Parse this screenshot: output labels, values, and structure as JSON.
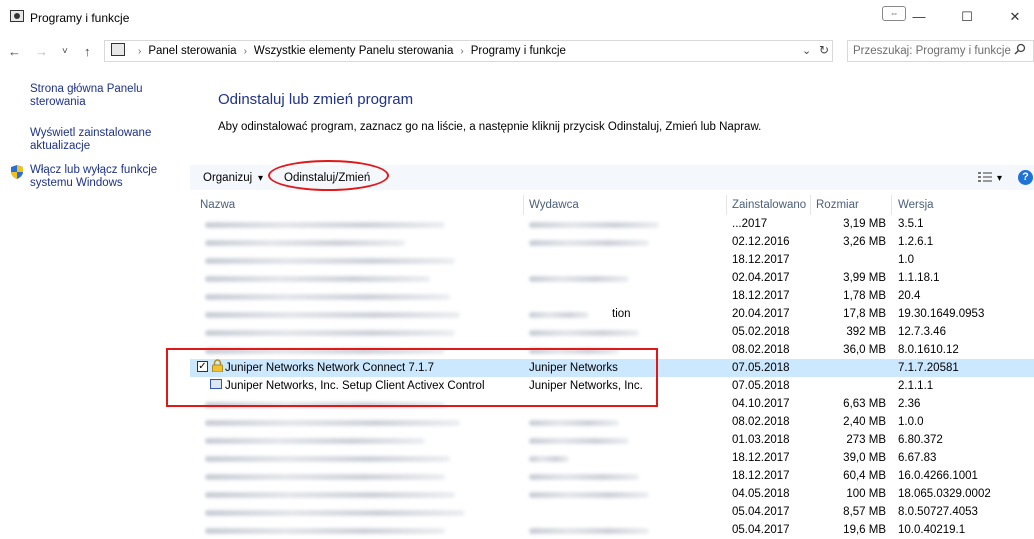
{
  "window": {
    "title": "Programy i funkcje",
    "minimize": "—",
    "maximize": "☐",
    "close": "✕"
  },
  "nav": {
    "back": "←",
    "forward": "→",
    "recent": "˅",
    "up": "↑"
  },
  "address": {
    "crumbs": [
      "Panel sterowania",
      "Wszystkie elementy Panelu sterowania",
      "Programy i funkcje"
    ],
    "dropdown": "⌄",
    "refresh": "↻"
  },
  "search": {
    "placeholder": "Przeszukaj: Programy i funkcje",
    "icon": "search-icon"
  },
  "sidebar": {
    "items": [
      {
        "label": "Strona główna Panelu sterowania"
      },
      {
        "label": "Wyświetl zainstalowane aktualizacje"
      },
      {
        "label": "Włącz lub wyłącz funkcje systemu Windows"
      }
    ]
  },
  "main": {
    "heading": "Odinstaluj lub zmień program",
    "description": "Aby odinstalować program, zaznacz go na liście, a następnie kliknij przycisk Odinstaluj, Zmień lub Napraw."
  },
  "toolbar": {
    "organize": "Organizuj",
    "organize_arrow": "▾",
    "uninstall": "Odinstaluj/Zmień",
    "view_arrow": "▾",
    "help": "?"
  },
  "columns": {
    "name": "Nazwa",
    "publisher": "Wydawca",
    "installed": "Zainstalowano",
    "size": "Rozmiar",
    "version": "Wersja"
  },
  "rows": [
    {
      "name": "",
      "publisher": "",
      "installed": "...2017",
      "size": "3,19 MB",
      "version": "3.5.1"
    },
    {
      "name": "",
      "publisher": "",
      "installed": "02.12.2016",
      "size": "3,26 MB",
      "version": "1.2.6.1"
    },
    {
      "name": "",
      "publisher": "",
      "installed": "18.12.2017",
      "size": "",
      "version": "1.0"
    },
    {
      "name": "",
      "publisher": "",
      "installed": "02.04.2017",
      "size": "3,99 MB",
      "version": "1.1.18.1"
    },
    {
      "name": "",
      "publisher": "",
      "installed": "18.12.2017",
      "size": "1,78 MB",
      "version": "20.4"
    },
    {
      "name": "",
      "publisher": "...tion",
      "installed": "20.04.2017",
      "size": "17,8 MB",
      "version": "19.30.1649.0953"
    },
    {
      "name": "",
      "publisher": "",
      "installed": "05.02.2018",
      "size": "392 MB",
      "version": "12.7.3.46"
    },
    {
      "name": "",
      "publisher": "",
      "installed": "08.02.2018",
      "size": "36,0 MB",
      "version": "8.0.1610.12"
    },
    {
      "name": "Juniper Networks Network Connect 7.1.7",
      "publisher": "Juniper Networks",
      "installed": "07.05.2018",
      "size": "",
      "version": "7.1.7.20581"
    },
    {
      "name": "Juniper Networks, Inc. Setup Client Activex Control",
      "publisher": "Juniper Networks, Inc.",
      "installed": "07.05.2018",
      "size": "",
      "version": "2.1.1.1"
    },
    {
      "name": "",
      "publisher": "",
      "installed": "04.10.2017",
      "size": "6,63 MB",
      "version": "2.36"
    },
    {
      "name": "",
      "publisher": "",
      "installed": "08.02.2018",
      "size": "2,40 MB",
      "version": "1.0.0"
    },
    {
      "name": "",
      "publisher": "",
      "installed": "01.03.2018",
      "size": "273 MB",
      "version": "6.80.372"
    },
    {
      "name": "",
      "publisher": "",
      "installed": "18.12.2017",
      "size": "39,0 MB",
      "version": "6.67.83"
    },
    {
      "name": "",
      "publisher": "",
      "installed": "18.12.2017",
      "size": "60,4 MB",
      "version": "16.0.4266.1001"
    },
    {
      "name": "",
      "publisher": "",
      "installed": "04.05.2018",
      "size": "100 MB",
      "version": "18.065.0329.0002"
    },
    {
      "name": "",
      "publisher": "",
      "installed": "05.04.2017",
      "size": "8,57 MB",
      "version": "8.0.50727.4053"
    },
    {
      "name": "",
      "publisher": "",
      "installed": "05.04.2017",
      "size": "19,6 MB",
      "version": "10.0.40219.1"
    }
  ],
  "colors": {
    "link": "#1e3287",
    "selection": "#cce8ff",
    "annotation": "#e01818"
  }
}
